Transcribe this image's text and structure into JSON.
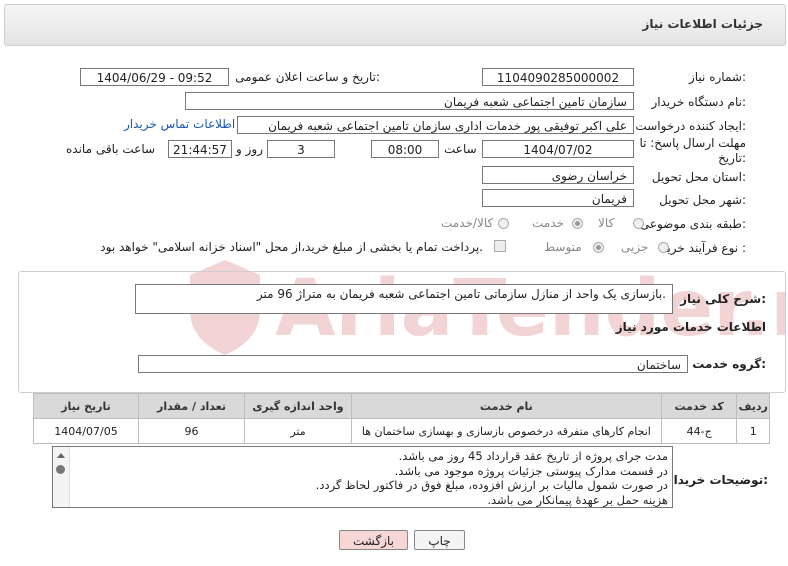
{
  "header": {
    "title": "جزئیات اطلاعات نیاز"
  },
  "form": {
    "need_number": {
      "label": "شماره نیاز:",
      "value": "1104090285000002"
    },
    "announce": {
      "label": "تاریخ و ساعت اعلان عمومی:",
      "value": "1404/06/29 - 09:52"
    },
    "buyer_org": {
      "label": "نام دستگاه خریدار:",
      "value": "سازمان تامین اجتماعی شعبه فریمان"
    },
    "creator": {
      "label": "ایجاد کننده درخواست:",
      "value": "علی اکبر توفیقی پور خدمات اداری سازمان تامین اجتماعی شعبه فریمان",
      "contact_link": "اطلاعات تماس خریدار"
    },
    "deadline": {
      "label": "مهلت ارسال پاسخ: تا تاریخ:",
      "date": "1404/07/02",
      "time_label": "ساعت",
      "time": "08:00",
      "days": "3",
      "days_label": "روز و",
      "remaining": "21:44:57",
      "remaining_label": "ساعت باقی مانده"
    },
    "province": {
      "label": "استان محل تحویل:",
      "value": "خراسان رضوی"
    },
    "city": {
      "label": "شهر محل تحویل:",
      "value": "فریمان"
    },
    "category": {
      "label": "طبقه بندی موضوعی:",
      "options": [
        "کالا",
        "خدمت",
        "کالا/خدمت"
      ],
      "selected": "خدمت"
    },
    "process": {
      "label": "نوع فرآیند خرید :",
      "options": [
        "جزیی",
        "متوسط"
      ],
      "selected": "متوسط",
      "treasury_note": "پرداخت تمام یا بخشی از مبلغ خرید،از محل \"اسناد خزانه اسلامی\" خواهد بود."
    }
  },
  "summary": {
    "label": "شرح کلی نیاز:",
    "text": "بازسازی یک واحد از منازل سازماتی تامین اجتماعی شعبه فریمان به متراژ 96 متر."
  },
  "services": {
    "section_title": "اطلاعات خدمات مورد نیاز",
    "group_label": "گروه خدمت:",
    "group_value": "ساختمان",
    "columns": [
      "ردیف",
      "کد خدمت",
      "نام خدمت",
      "واحد اندازه گیری",
      "تعداد / مقدار",
      "تاریخ نیاز"
    ],
    "rows": [
      {
        "row": "1",
        "code": "ج-44",
        "name": "انجام کارهای متفرقه درخصوص بازسازی و بهسازی ساختمان ها",
        "unit": "متر",
        "qty": "96",
        "date": "1404/07/05"
      }
    ]
  },
  "notes": {
    "label": "توضیحات خریدار:",
    "lines": [
      "مدت جرای پروژه از تاریخ عقد قرارداد 45 روز می باشد.",
      "در قسمت مدارک پیوستی جزئیات پروژه موجود می باشد.",
      "در صورت شمول مالیات بر ارزش افزوده، مبلغ فوق در فاکتور لحاظ گردد.",
      "هزینه حمل بر عهدهٔ پیمانکار می باشد."
    ]
  },
  "buttons": {
    "print": "چاپ",
    "back": "بازگشت"
  },
  "colors": {
    "link": "#1a56b3",
    "back_button_bg": "#f7d6d6",
    "header_bg": "#ececec"
  },
  "watermark": {
    "text": "AriaTender.neT"
  }
}
